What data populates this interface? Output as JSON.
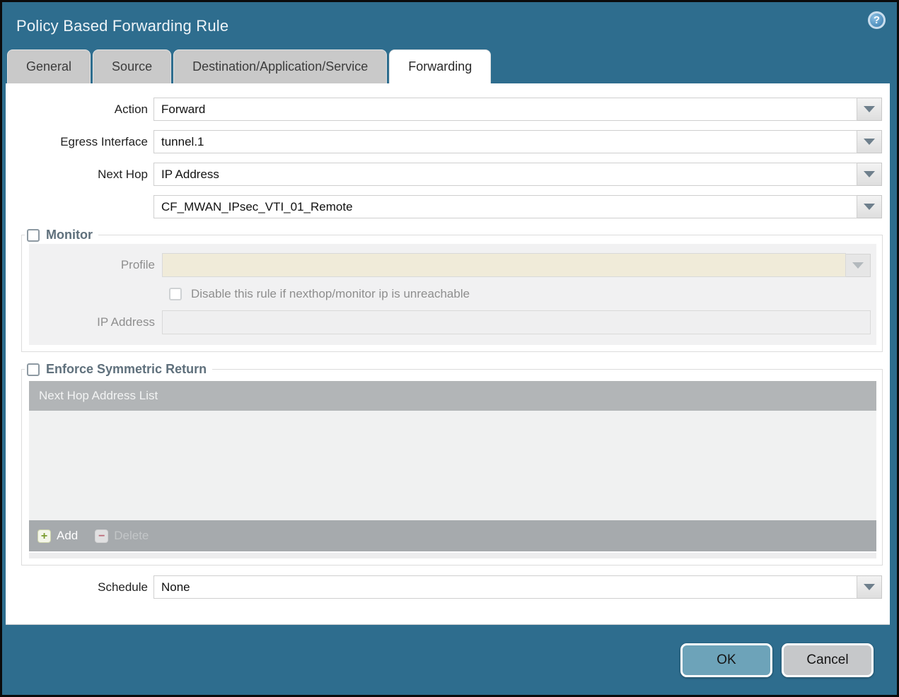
{
  "dialog": {
    "title": "Policy Based Forwarding Rule",
    "help_glyph": "?"
  },
  "tabs": [
    {
      "label": "General",
      "active": false
    },
    {
      "label": "Source",
      "active": false
    },
    {
      "label": "Destination/Application/Service",
      "active": false
    },
    {
      "label": "Forwarding",
      "active": true
    }
  ],
  "form": {
    "action": {
      "label": "Action",
      "value": "Forward"
    },
    "egress_interface": {
      "label": "Egress Interface",
      "value": "tunnel.1"
    },
    "next_hop": {
      "label": "Next Hop",
      "value": "IP Address"
    },
    "next_hop_address": {
      "value": "CF_MWAN_IPsec_VTI_01_Remote"
    },
    "schedule": {
      "label": "Schedule",
      "value": "None"
    }
  },
  "monitor": {
    "legend": "Monitor",
    "checked": false,
    "profile": {
      "label": "Profile",
      "value": ""
    },
    "disable_rule": {
      "label": "Disable this rule if nexthop/monitor ip is unreachable",
      "checked": false
    },
    "ip_address": {
      "label": "IP Address",
      "value": ""
    }
  },
  "symmetric_return": {
    "legend": "Enforce Symmetric Return",
    "checked": false,
    "table": {
      "header": "Next Hop Address List",
      "rows": []
    },
    "toolbar": {
      "add_label": "Add",
      "delete_label": "Delete",
      "add_glyph": "+",
      "delete_glyph": "−"
    }
  },
  "footer": {
    "ok_label": "OK",
    "cancel_label": "Cancel"
  },
  "colors": {
    "titlebar": "#2e6d8e",
    "tab_inactive": "#c9c9c9",
    "tab_text": "#3c3c3c",
    "legend_text": "#5f707c",
    "table_header_bg": "#b2b5b7",
    "table_body_bg": "#f0f1f1",
    "table_footer_bg": "#a6aaad",
    "profile_field_bg": "#f0ebd9",
    "ok_button": "#6da3b9",
    "cancel_button": "#c6c8ca",
    "arrow": "#6e7f8c",
    "add_plus": "#7a9c2e",
    "delete_minus": "#c25a6a"
  }
}
